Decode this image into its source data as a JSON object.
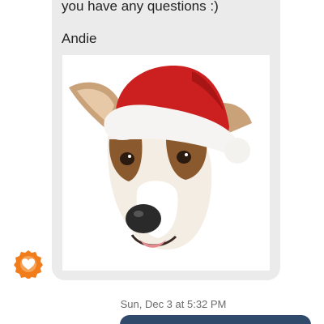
{
  "message": {
    "line_1": "you have any questions :)",
    "line_2": "Andie",
    "image": "dog-with-santa-hat-photo"
  },
  "sender_avatar": {
    "icon": "heart-badge-icon",
    "color": "#f07c1b"
  },
  "timestamp": "Sun, Dec 3 at 5:32 PM",
  "colors": {
    "incoming_bubble": "#ebebeb",
    "outgoing_bubble": "#2f4a6b"
  }
}
